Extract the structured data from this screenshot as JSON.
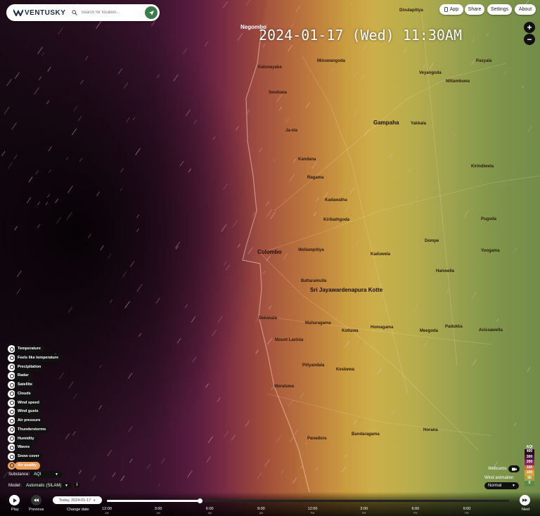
{
  "header": {
    "logo_text": "VENTUSKY",
    "search_placeholder": "Search for location..."
  },
  "top_buttons": [
    {
      "label": "App",
      "icon": "phone-icon"
    },
    {
      "label": "Share"
    },
    {
      "label": "Settings"
    },
    {
      "label": "About"
    }
  ],
  "zoom": {
    "in": "+",
    "out": "−"
  },
  "datetime": "2024-01-17 (Wed) 11:30AM",
  "map_places": [
    {
      "name": "Negombo",
      "big": true
    },
    {
      "name": "Gampaha",
      "big": true
    },
    {
      "name": "Colombo",
      "big": true
    },
    {
      "name": "Sri Jayawardenapura Kotte",
      "big": true
    },
    {
      "name": "Divulapitiya"
    },
    {
      "name": "Minuwangoda"
    },
    {
      "name": "Veyangoda"
    },
    {
      "name": "Nittambuwa"
    },
    {
      "name": "Pasyala"
    },
    {
      "name": "Katunayaka"
    },
    {
      "name": "Seeduwa"
    },
    {
      "name": "Ja-ela"
    },
    {
      "name": "Yakkala"
    },
    {
      "name": "Kandana"
    },
    {
      "name": "Ragama"
    },
    {
      "name": "Kiribathgoda"
    },
    {
      "name": "Kadawatha"
    },
    {
      "name": "Dompe"
    },
    {
      "name": "Kaduwela"
    },
    {
      "name": "Hanwella"
    },
    {
      "name": "Wellampitiya"
    },
    {
      "name": "Battaramulla"
    },
    {
      "name": "Maharagama"
    },
    {
      "name": "Homagama"
    },
    {
      "name": "Kottawa"
    },
    {
      "name": "Dehiwala"
    },
    {
      "name": "Mount Lavinia"
    },
    {
      "name": "Piliyandala"
    },
    {
      "name": "Kesbewa"
    },
    {
      "name": "Moratuwa"
    },
    {
      "name": "Panadura"
    },
    {
      "name": "Bandaragama"
    },
    {
      "name": "Horana"
    },
    {
      "name": "Padukka"
    },
    {
      "name": "Meegoda"
    },
    {
      "name": "Avissawella"
    },
    {
      "name": "Kirindiwela"
    },
    {
      "name": "Pugoda"
    },
    {
      "name": "Yoogama"
    }
  ],
  "layers": [
    {
      "label": "Temperature",
      "active": false
    },
    {
      "label": "Feels like temperature",
      "active": false
    },
    {
      "label": "Precipitation",
      "active": false
    },
    {
      "label": "Radar",
      "active": false
    },
    {
      "label": "Satellite",
      "active": false
    },
    {
      "label": "Clouds",
      "active": false
    },
    {
      "label": "Wind speed",
      "active": false
    },
    {
      "label": "Wind gusts",
      "active": false
    },
    {
      "label": "Air pressure",
      "active": false
    },
    {
      "label": "Thunderstorms",
      "active": false
    },
    {
      "label": "Humidity",
      "active": false
    },
    {
      "label": "Waves",
      "active": false
    },
    {
      "label": "Snow cover",
      "active": false
    },
    {
      "label": "Air quality",
      "active": true
    }
  ],
  "substance": {
    "label": "Substance:",
    "value": "AQI"
  },
  "model": {
    "label": "Model:",
    "value": "Automatic (SILAM)"
  },
  "legend": {
    "unit": "AQI",
    "entries": [
      {
        "value": "400",
        "color": "#2a0a22"
      },
      {
        "value": "300",
        "color": "#4a1a3a"
      },
      {
        "value": "200",
        "color": "#8a2a5a"
      },
      {
        "value": "150",
        "color": "#d07040"
      },
      {
        "value": "100",
        "color": "#d8a040"
      },
      {
        "value": "50",
        "color": "#a8a040"
      },
      {
        "value": "0",
        "color": "#5a8a4a"
      }
    ]
  },
  "webcams_label": "Webcams",
  "wind_animation": {
    "label": "Wind animation",
    "value": "Normal"
  },
  "controls": {
    "play": "Play",
    "previous": "Previous",
    "change_date": "Change date",
    "date_value": "Today, 2024-01-17",
    "next": "Next"
  },
  "timeline": {
    "progress": 0.23,
    "ticks": [
      {
        "time": "12:00",
        "ampm": "AM"
      },
      {
        "time": "3:00",
        "ampm": "AM"
      },
      {
        "time": "6:00",
        "ampm": "AM"
      },
      {
        "time": "9:00",
        "ampm": "AM"
      },
      {
        "time": "12:00",
        "ampm": "PM"
      },
      {
        "time": "3:00",
        "ampm": "PM"
      },
      {
        "time": "6:00",
        "ampm": "PM"
      },
      {
        "time": "9:00",
        "ampm": "PM"
      }
    ]
  }
}
